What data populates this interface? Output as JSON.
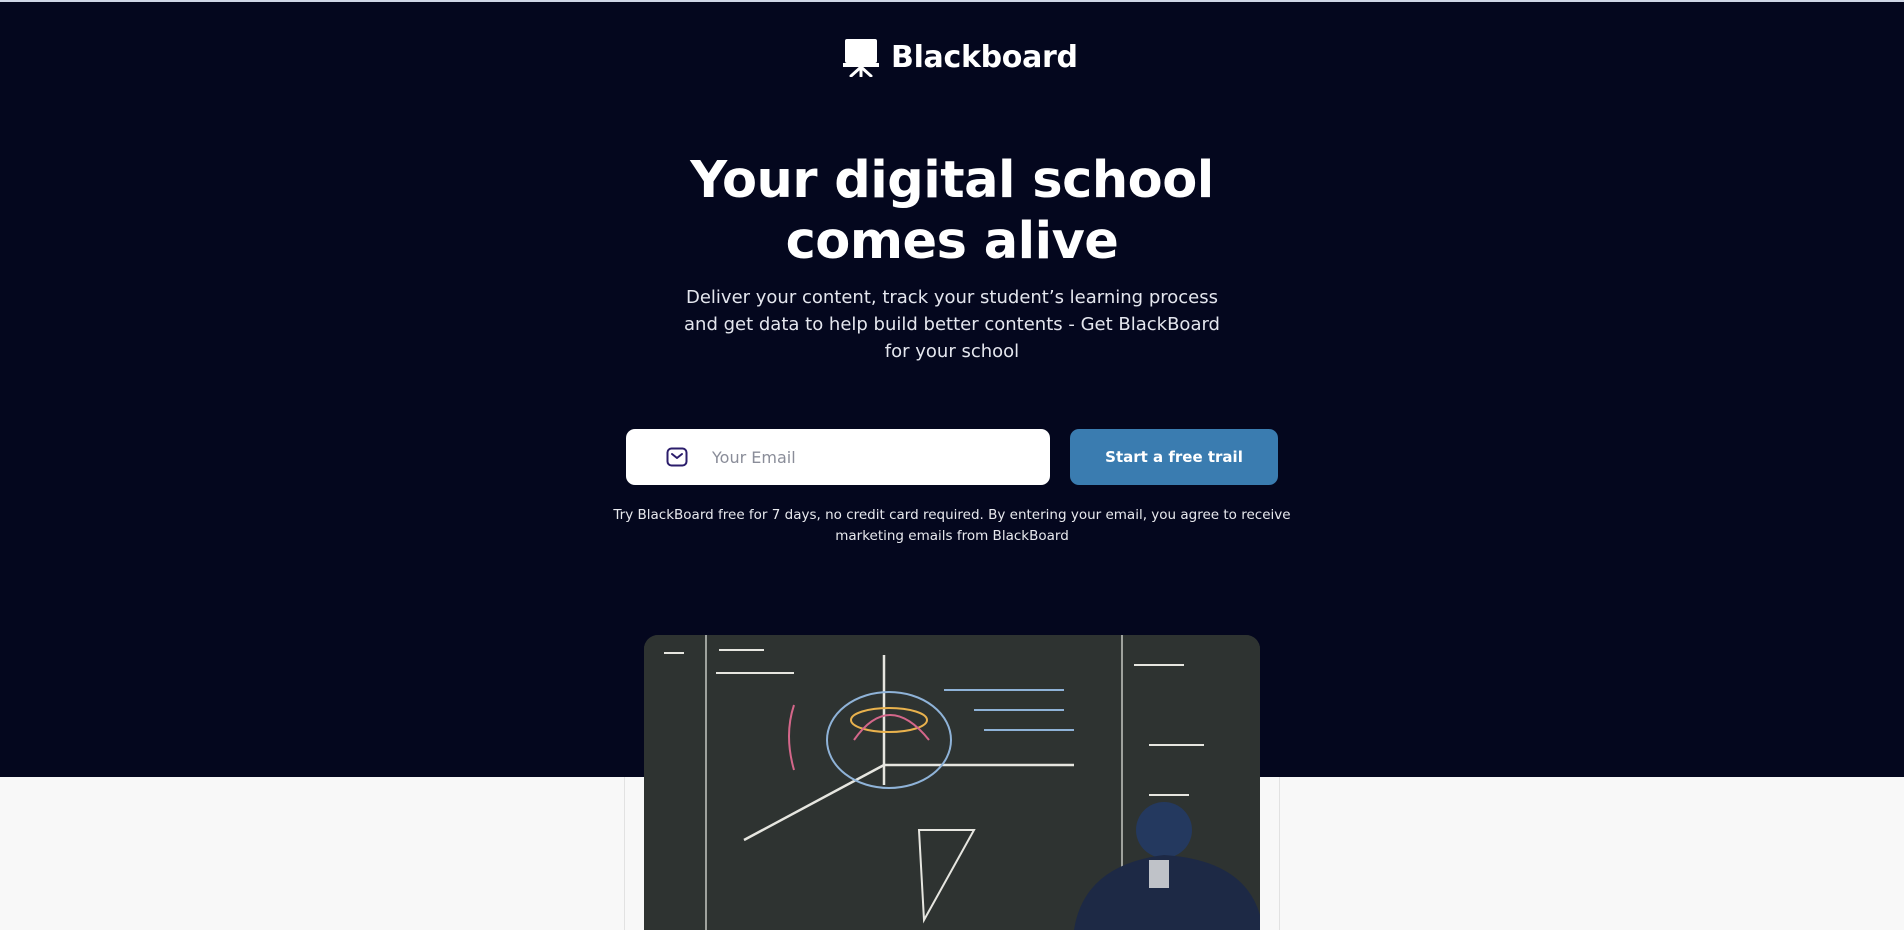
{
  "brand": {
    "name": "Blackboard",
    "icon": "easel-icon"
  },
  "hero": {
    "headline_line1": "Your digital school",
    "headline_line2": "comes alive",
    "subtitle": "Deliver your content, track your student’s learning process and get data to help build better contents - Get BlackBoard for your school"
  },
  "signup": {
    "email_placeholder": "Your Email",
    "email_value": "",
    "mail_icon": "mail-icon",
    "cta_label": "Start a free trail",
    "disclaimer": "Try BlackBoard free for 7 days, no credit card required. By entering your email, you agree to receive marketing emails from BlackBoard"
  },
  "colors": {
    "hero_bg": "#04071e",
    "cta_bg": "#3a7cb0",
    "page_bg": "#f8f8f8"
  }
}
